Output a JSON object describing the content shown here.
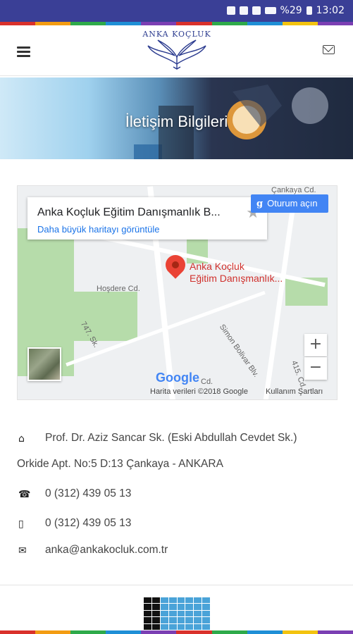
{
  "status_bar": {
    "battery": "%29",
    "time": "13:02"
  },
  "strip_colors": [
    "#d9312b",
    "#f39c12",
    "#2eaa4a",
    "#1f8fd6",
    "#7b3fb3",
    "#d9312b",
    "#2eaa4a",
    "#1f8fd6",
    "#f3c30f",
    "#7b3fb3"
  ],
  "header": {
    "logo_text": "ANKA KOÇLUK"
  },
  "hero": {
    "title": "İletişim Bilgileri"
  },
  "map": {
    "place_name": "Anka Koçluk Eğitim Danışmanlık B...",
    "larger_map_link": "Daha büyük haritayı görüntüle",
    "signin_label": "Oturum açın",
    "pin_label_line1": "Anka Koçluk",
    "pin_label_line2": "Eğitim Danışmanlık...",
    "streets": [
      "Hoşdere Cd.",
      "747. Sk.",
      "Simon Bolivar Blv.",
      "415. Cd.",
      "Çankaya Cd.",
      "Cd."
    ],
    "zoom_in": "+",
    "zoom_out": "−",
    "google_logo": "Google",
    "map_data": "Harita verileri ©2018 Google",
    "terms": "Kullanım Şartları"
  },
  "contact": {
    "address_line1": "Prof. Dr. Aziz Sancar Sk. (Eski Abdullah Cevdet Sk.)",
    "address_line2": "Orkide Apt. No:5 D:13 Çankaya - ANKARA",
    "phone": "0 (312) 439 05 13",
    "mobile": "0 (312) 439 05 13",
    "email": "anka@ankakocluk.com.tr"
  }
}
